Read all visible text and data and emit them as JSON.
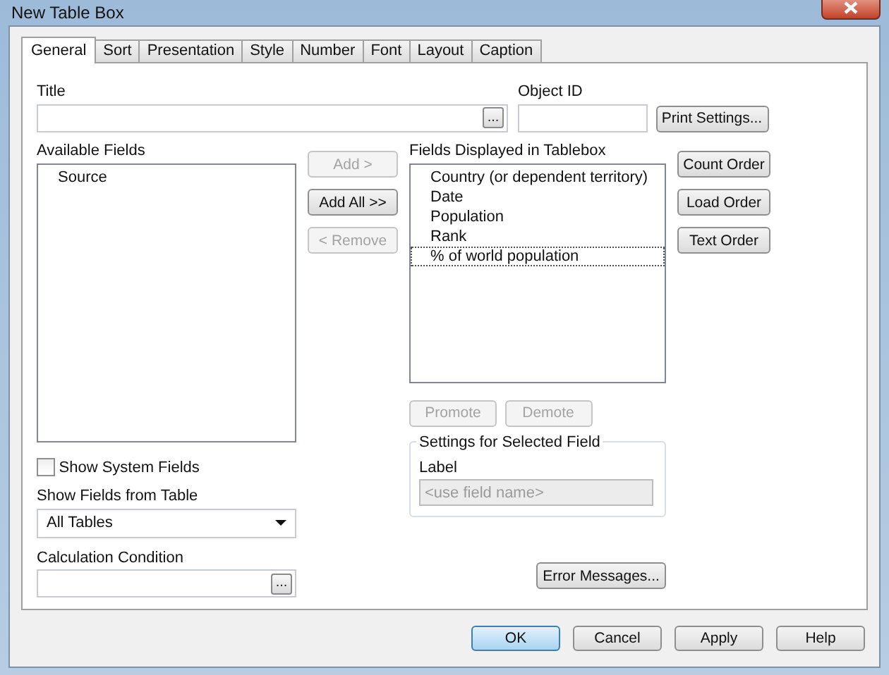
{
  "window": {
    "title": "New Table Box"
  },
  "tabs": [
    {
      "label": "General",
      "selected": true
    },
    {
      "label": "Sort",
      "selected": false
    },
    {
      "label": "Presentation",
      "selected": false
    },
    {
      "label": "Style",
      "selected": false
    },
    {
      "label": "Number",
      "selected": false
    },
    {
      "label": "Font",
      "selected": false
    },
    {
      "label": "Layout",
      "selected": false
    },
    {
      "label": "Caption",
      "selected": false
    }
  ],
  "title_field": {
    "label": "Title",
    "button": "..."
  },
  "object_id": {
    "label": "Object ID"
  },
  "print_settings": {
    "label": "Print Settings..."
  },
  "available_fields": {
    "label": "Available Fields",
    "items": [
      {
        "text": "Source",
        "selected": false
      }
    ]
  },
  "move_buttons": [
    {
      "label": "Add >",
      "disabled": true
    },
    {
      "label": "Add All >>",
      "disabled": false
    },
    {
      "label": "< Remove",
      "disabled": true
    }
  ],
  "displayed_fields": {
    "label": "Fields Displayed in Tablebox",
    "items": [
      {
        "text": "Country (or dependent territory)",
        "selected": false
      },
      {
        "text": "Date",
        "selected": false
      },
      {
        "text": "Population",
        "selected": false
      },
      {
        "text": "Rank",
        "selected": false
      },
      {
        "text": "% of world population",
        "selected": true
      }
    ]
  },
  "order_buttons": [
    {
      "label": "Count Order",
      "disabled": false
    },
    {
      "label": "Load Order",
      "disabled": false
    },
    {
      "label": "Text Order",
      "disabled": false
    }
  ],
  "show_system_fields": {
    "label": "Show System Fields",
    "checked": false
  },
  "show_fields_from_table": {
    "label": "Show Fields from Table",
    "value": "All Tables"
  },
  "calculation_condition": {
    "label": "Calculation Condition",
    "button": "..."
  },
  "promote_buttons": [
    {
      "label": "Promote",
      "disabled": true
    },
    {
      "label": "Demote",
      "disabled": true
    }
  ],
  "settings_group": {
    "title": "Settings for Selected Field",
    "field_label": "Label",
    "placeholder": "<use field name>"
  },
  "error_messages": {
    "label": "Error Messages..."
  },
  "footer_buttons": [
    {
      "label": "OK",
      "default": true
    },
    {
      "label": "Cancel",
      "default": false
    },
    {
      "label": "Apply",
      "default": false
    },
    {
      "label": "Help",
      "default": false
    }
  ]
}
